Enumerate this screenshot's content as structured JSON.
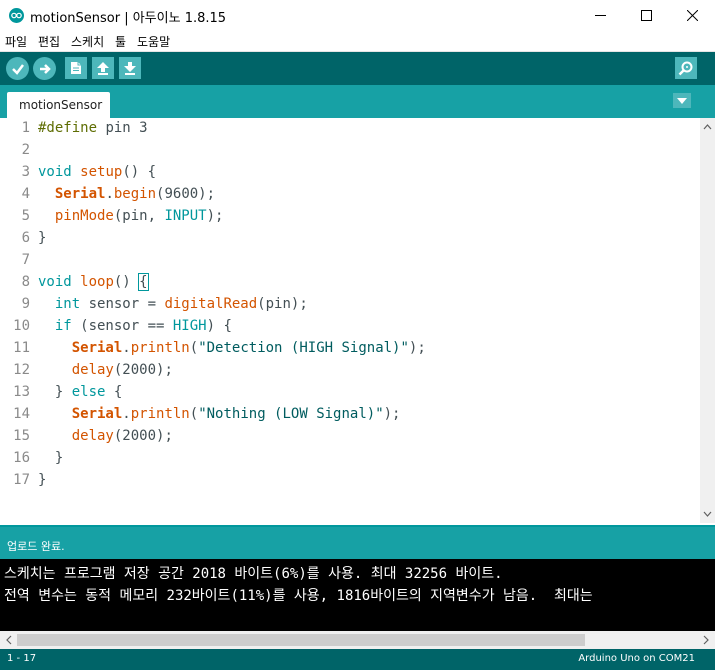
{
  "window": {
    "title": "motionSensor | 아두이노 1.8.15"
  },
  "menu": [
    "파일",
    "편집",
    "스케치",
    "툴",
    "도움말"
  ],
  "toolbar": {
    "buttons": [
      "check-icon",
      "arrow-right-icon",
      "new-file-icon",
      "upload-arrow-icon",
      "download-arrow-icon"
    ],
    "serial_monitor": "magnifier-icon"
  },
  "tabs": [
    {
      "label": "motionSensor"
    }
  ],
  "editor": {
    "line_numbers": [
      "1",
      "2",
      "3",
      "4",
      "5",
      "6",
      "7",
      "8",
      "9",
      "10",
      "11",
      "12",
      "13",
      "14",
      "15",
      "16",
      "17"
    ],
    "lines": [
      [
        {
          "t": "#define",
          "c": "pp"
        },
        {
          "t": " pin 3"
        }
      ],
      [],
      [
        {
          "t": "void",
          "c": "kw"
        },
        {
          "t": " "
        },
        {
          "t": "setup",
          "c": "fn"
        },
        {
          "t": "() {"
        }
      ],
      [
        {
          "t": "  "
        },
        {
          "t": "Serial",
          "c": "cls"
        },
        {
          "t": "."
        },
        {
          "t": "begin",
          "c": "fn"
        },
        {
          "t": "(9600);"
        }
      ],
      [
        {
          "t": "  "
        },
        {
          "t": "pinMode",
          "c": "fn"
        },
        {
          "t": "(pin, "
        },
        {
          "t": "INPUT",
          "c": "kw"
        },
        {
          "t": ");"
        }
      ],
      [
        {
          "t": "}"
        }
      ],
      [],
      [
        {
          "t": "void",
          "c": "kw"
        },
        {
          "t": " "
        },
        {
          "t": "loop",
          "c": "fn"
        },
        {
          "t": "() "
        },
        {
          "t": "{",
          "c": "hl"
        }
      ],
      [
        {
          "t": "  "
        },
        {
          "t": "int",
          "c": "kw"
        },
        {
          "t": " sensor = "
        },
        {
          "t": "digitalRead",
          "c": "fn"
        },
        {
          "t": "(pin);"
        }
      ],
      [
        {
          "t": "  "
        },
        {
          "t": "if",
          "c": "kw"
        },
        {
          "t": " (sensor == "
        },
        {
          "t": "HIGH",
          "c": "kw"
        },
        {
          "t": ") {"
        }
      ],
      [
        {
          "t": "    "
        },
        {
          "t": "Serial",
          "c": "cls"
        },
        {
          "t": "."
        },
        {
          "t": "println",
          "c": "fn"
        },
        {
          "t": "("
        },
        {
          "t": "\"Detection (HIGH Signal)\"",
          "c": "str"
        },
        {
          "t": ");"
        }
      ],
      [
        {
          "t": "    "
        },
        {
          "t": "delay",
          "c": "fn"
        },
        {
          "t": "(2000);"
        }
      ],
      [
        {
          "t": "  } "
        },
        {
          "t": "else",
          "c": "kw"
        },
        {
          "t": " {"
        }
      ],
      [
        {
          "t": "    "
        },
        {
          "t": "Serial",
          "c": "cls"
        },
        {
          "t": "."
        },
        {
          "t": "println",
          "c": "fn"
        },
        {
          "t": "("
        },
        {
          "t": "\"Nothing (LOW Signal)\"",
          "c": "str"
        },
        {
          "t": ");"
        }
      ],
      [
        {
          "t": "    "
        },
        {
          "t": "delay",
          "c": "fn"
        },
        {
          "t": "(2000);"
        }
      ],
      [
        {
          "t": "  }"
        }
      ],
      [
        {
          "t": "}"
        }
      ]
    ]
  },
  "status": {
    "message": "업로드 완료."
  },
  "console": {
    "lines": [
      "스케치는 프로그램 저장 공간 2018 바이트(6%)를 사용. 최대 32256 바이트.",
      "전역 변수는 동적 메모리 232바이트(11%)를 사용, 1816바이트의 지역변수가 남음.  최대는"
    ]
  },
  "bottom": {
    "line_info": "1 - 17",
    "board": "Arduino Uno on COM21"
  },
  "colors": {
    "toolbar": "#006468",
    "tabbar": "#17a1a5",
    "button": "#4db7bb",
    "keyword": "#00979c",
    "function": "#d35400"
  }
}
